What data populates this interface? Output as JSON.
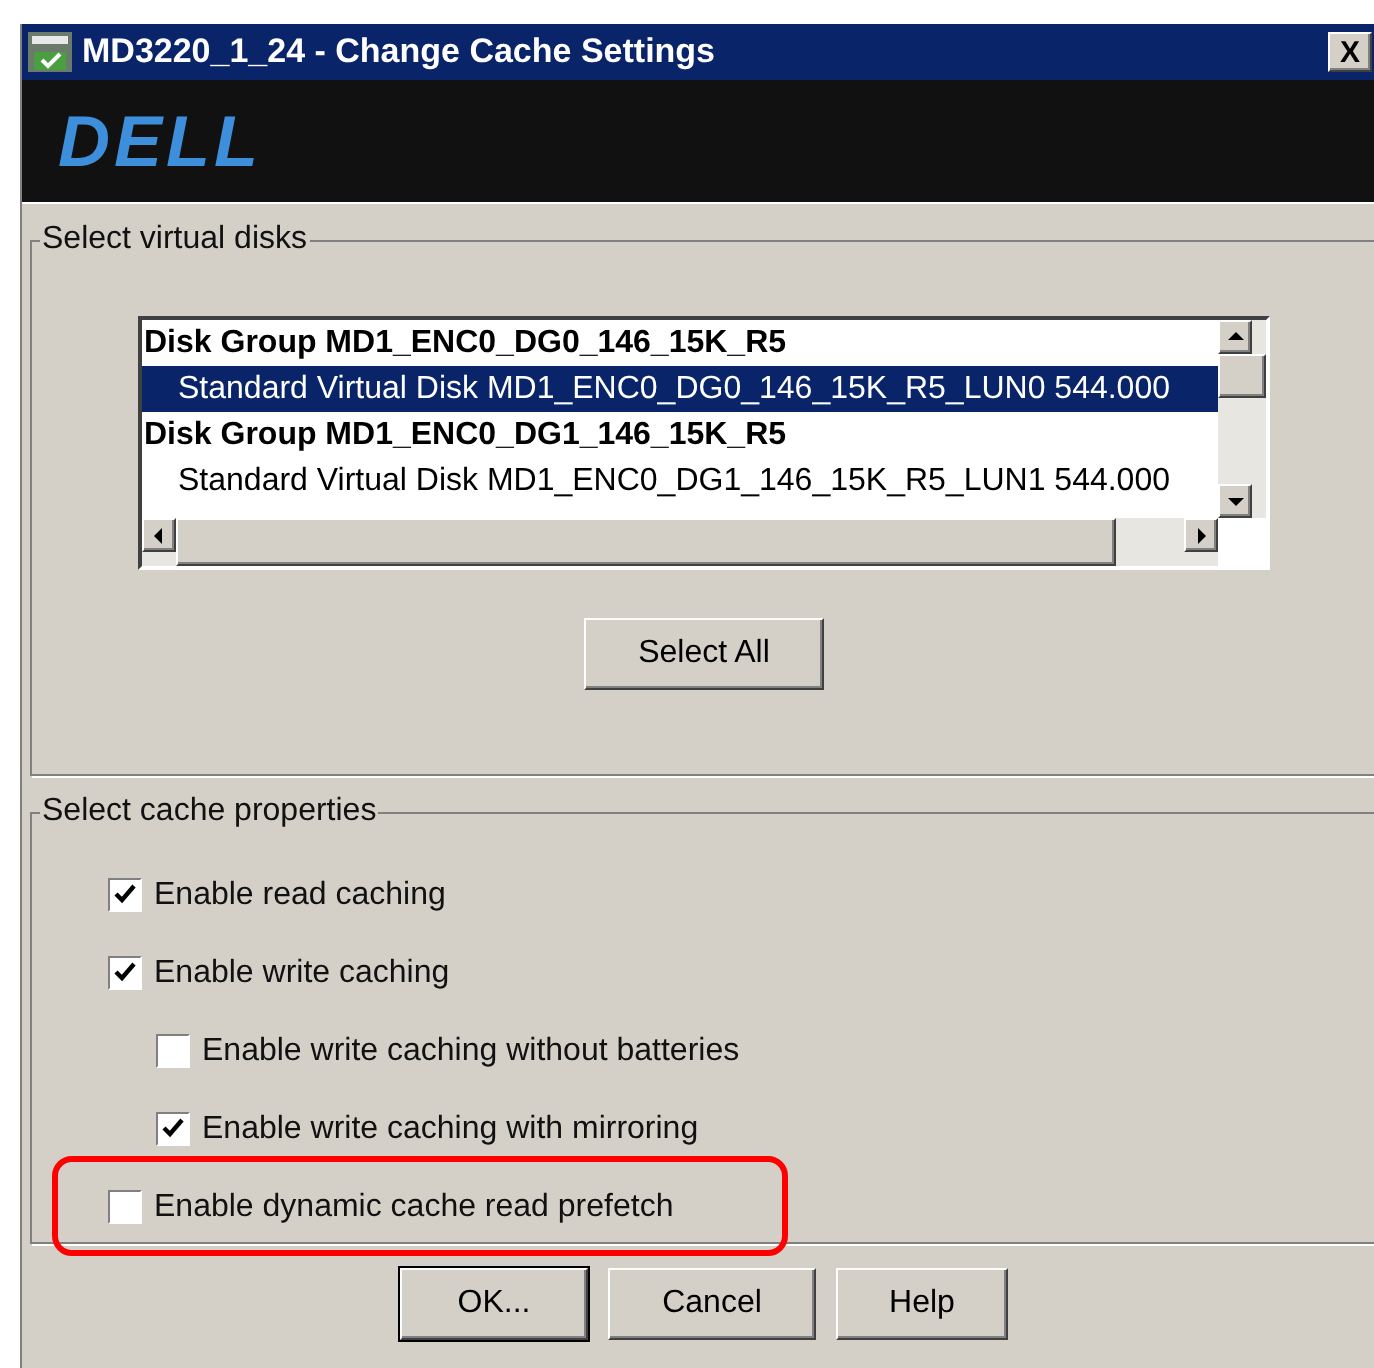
{
  "window": {
    "title": "MD3220_1_24 - Change Cache Settings",
    "close": "X"
  },
  "banner": {
    "logo": "DELL"
  },
  "virtual_disks": {
    "legend": "Select virtual disks",
    "items": [
      {
        "kind": "group",
        "label": "Disk Group MD1_ENC0_DG0_146_15K_R5",
        "selected": false
      },
      {
        "kind": "disk",
        "label": "Standard Virtual Disk  MD1_ENC0_DG0_146_15K_R5_LUN0  544.000",
        "selected": true
      },
      {
        "kind": "group",
        "label": "Disk Group MD1_ENC0_DG1_146_15K_R5",
        "selected": false
      },
      {
        "kind": "disk",
        "label": "Standard Virtual Disk  MD1_ENC0_DG1_146_15K_R5_LUN1  544.000",
        "selected": false
      }
    ],
    "select_all": "Select All"
  },
  "cache_properties": {
    "legend": "Select cache properties",
    "options": [
      {
        "label": "Enable read caching",
        "checked": true,
        "indented": false,
        "highlighted": false
      },
      {
        "label": "Enable write caching",
        "checked": true,
        "indented": false,
        "highlighted": false
      },
      {
        "label": "Enable write caching without batteries",
        "checked": false,
        "indented": true,
        "highlighted": false
      },
      {
        "label": "Enable write caching with mirroring",
        "checked": true,
        "indented": true,
        "highlighted": false
      },
      {
        "label": "Enable dynamic cache read prefetch",
        "checked": false,
        "indented": false,
        "highlighted": true
      }
    ]
  },
  "buttons": [
    "OK...",
    "Cancel",
    "Help"
  ]
}
